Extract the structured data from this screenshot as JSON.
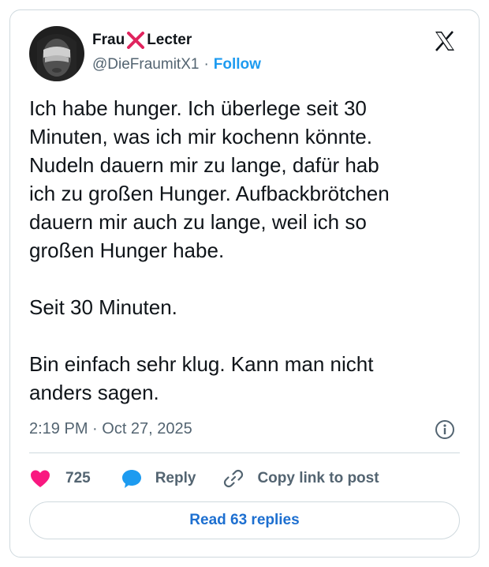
{
  "author": {
    "name_left": "Frau",
    "name_right": "Lecter",
    "handle": "@DieFraumitX1",
    "separator": "·",
    "follow_label": "Follow"
  },
  "icons": {
    "name_separator": "cross-mark-icon",
    "platform_logo": "x-logo-icon",
    "info": "info-icon",
    "like": "heart-icon",
    "reply": "speech-bubble-icon",
    "copy_link": "link-icon"
  },
  "tweet": {
    "text": "Ich habe hunger. Ich überlege seit 30\nMinuten, was ich mir kochenn könnte.\nNudeln dauern mir zu lange, dafür hab\nich zu großen Hunger. Aufbackbrötchen\ndauern mir auch zu lange, weil ich so\ngroßen Hunger habe.\n\nSeit 30 Minuten.\n\nBin einfach sehr klug. Kann man nicht\nanders sagen.",
    "timestamp": "2:19 PM · Oct 27, 2025"
  },
  "actions": {
    "like_count": "725",
    "reply_label": "Reply",
    "copy_link_label": "Copy link to post"
  },
  "read_replies_label": "Read 63 replies",
  "colors": {
    "accent": "#1d9bf0",
    "link_text": "#1d6fd0",
    "heart": "#f91880",
    "cross": "#e0245e",
    "muted": "#536471",
    "border": "#cfd9de"
  }
}
